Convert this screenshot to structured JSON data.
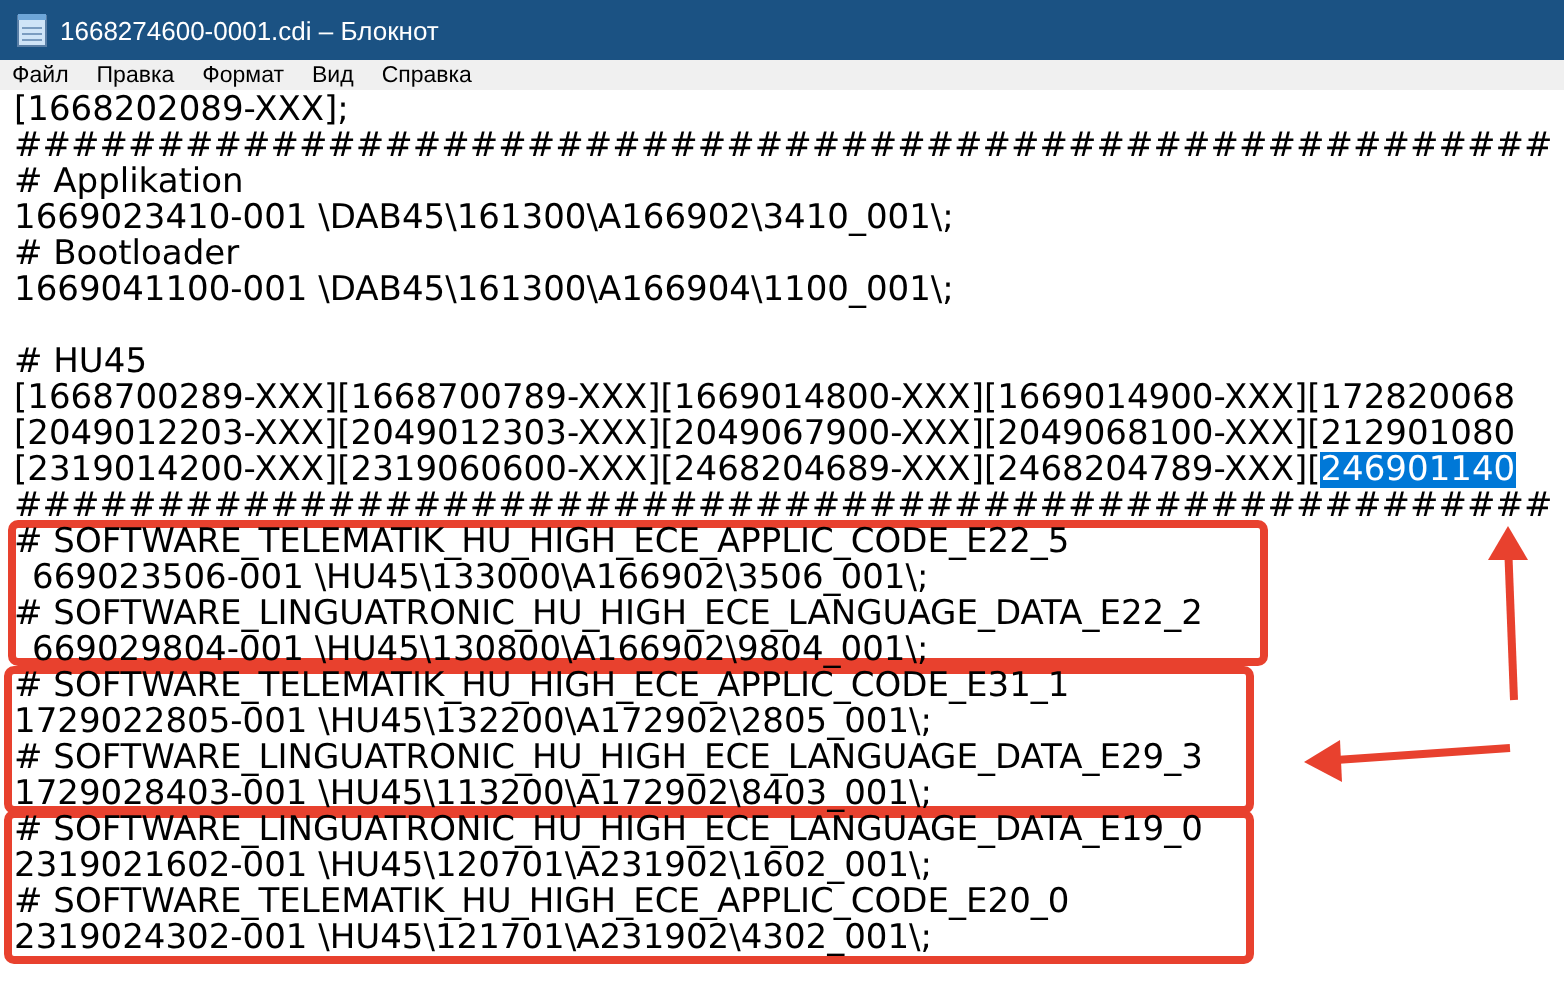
{
  "window": {
    "title": "1668274600-0001.cdi – Блокнот"
  },
  "menu": [
    "Файл",
    "Правка",
    "Формат",
    "Вид",
    "Справка"
  ],
  "editor": {
    "lines": [
      {
        "kind": "text",
        "text": "[1668202089-XXX];"
      },
      {
        "kind": "text",
        "text": "######################################################"
      },
      {
        "kind": "text",
        "text": "# Applikation"
      },
      {
        "kind": "text",
        "text": "1669023410-001 \\DAB45\\161300\\A166902\\3410_001\\;"
      },
      {
        "kind": "text",
        "text": "# Bootloader"
      },
      {
        "kind": "text",
        "text": "1669041100-001 \\DAB45\\161300\\A166904\\1100_001\\;"
      },
      {
        "kind": "blank"
      },
      {
        "kind": "text",
        "text": "# HU45"
      },
      {
        "kind": "text",
        "text": "[1668700289-XXX][1668700789-XXX][1669014800-XXX][1669014900-XXX][172820068"
      },
      {
        "kind": "text",
        "text": "[2049012203-XXX][2049012303-XXX][2049067900-XXX][2049068100-XXX][212901080"
      },
      {
        "kind": "text",
        "text": "[2319014200-XXX][2319060600-XXX][2468204689-XXX][2468204789-XXX][",
        "selection": "246901140"
      },
      {
        "kind": "text",
        "text": "######################################################"
      },
      {
        "kind": "text",
        "text": "# SOFTWARE_TELEMATIK_HU_HIGH_ECE_APPLIC_CODE_E22_5"
      },
      {
        "kind": "cut",
        "text": "669023506-001 \\HU45\\133000\\A166902\\3506_001\\;"
      },
      {
        "kind": "text",
        "text": "# SOFTWARE_LINGUATRONIC_HU_HIGH_ECE_LANGUAGE_DATA_E22_2"
      },
      {
        "kind": "cut",
        "text": "669029804-001 \\HU45\\130800\\A166902\\9804_001\\;"
      },
      {
        "kind": "text",
        "text": "# SOFTWARE_TELEMATIK_HU_HIGH_ECE_APPLIC_CODE_E31_1"
      },
      {
        "kind": "text",
        "text": "1729022805-001 \\HU45\\132200\\A172902\\2805_001\\;"
      },
      {
        "kind": "text",
        "text": "# SOFTWARE_LINGUATRONIC_HU_HIGH_ECE_LANGUAGE_DATA_E29_3"
      },
      {
        "kind": "text",
        "text": "1729028403-001 \\HU45\\113200\\A172902\\8403_001\\;"
      },
      {
        "kind": "text",
        "text": "# SOFTWARE_LINGUATRONIC_HU_HIGH_ECE_LANGUAGE_DATA_E19_0"
      },
      {
        "kind": "text",
        "text": "2319021602-001 \\HU45\\120701\\A231902\\1602_001\\;"
      },
      {
        "kind": "text",
        "text": "# SOFTWARE_TELEMATIK_HU_HIGH_ECE_APPLIC_CODE_E20_0"
      },
      {
        "kind": "text",
        "text": "2319024302-001 \\HU45\\121701\\A231902\\4302_001\\;"
      }
    ]
  }
}
